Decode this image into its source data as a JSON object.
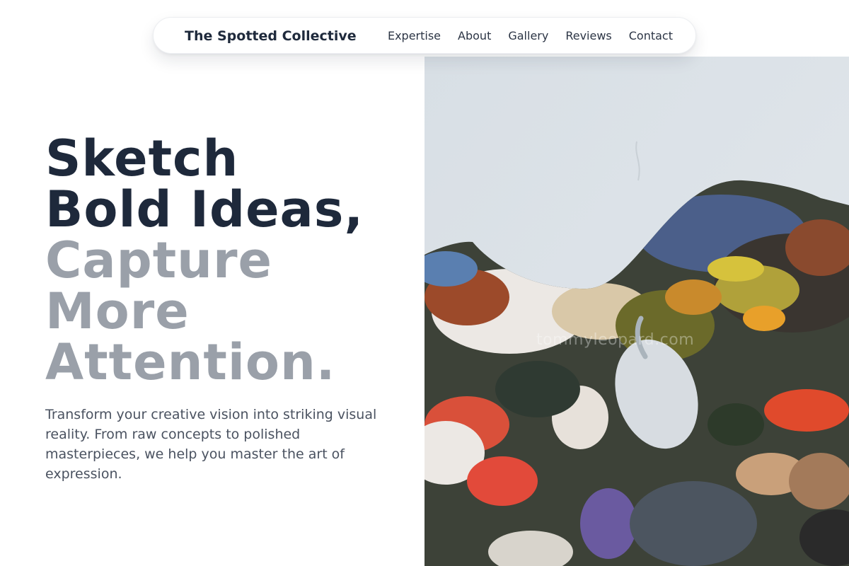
{
  "nav": {
    "brand": "The Spotted Collective",
    "links": [
      "Expertise",
      "About",
      "Gallery",
      "Reviews",
      "Contact"
    ]
  },
  "hero": {
    "heading_dark": [
      "Sketch",
      "Bold Ideas,"
    ],
    "heading_muted": [
      "Capture",
      "More",
      "Attention."
    ],
    "description": "Transform your creative vision into striking visual reality. From raw concepts to polished masterpieces, we help you master the art of expression."
  },
  "image": {
    "watermark": "tommyleopard.com",
    "subject": "paint-palette-photo"
  },
  "colors": {
    "heading_dark": "#1e293b",
    "heading_muted": "#9aa0a9",
    "body_text": "#4a5260",
    "wall": "#dde3e8"
  }
}
